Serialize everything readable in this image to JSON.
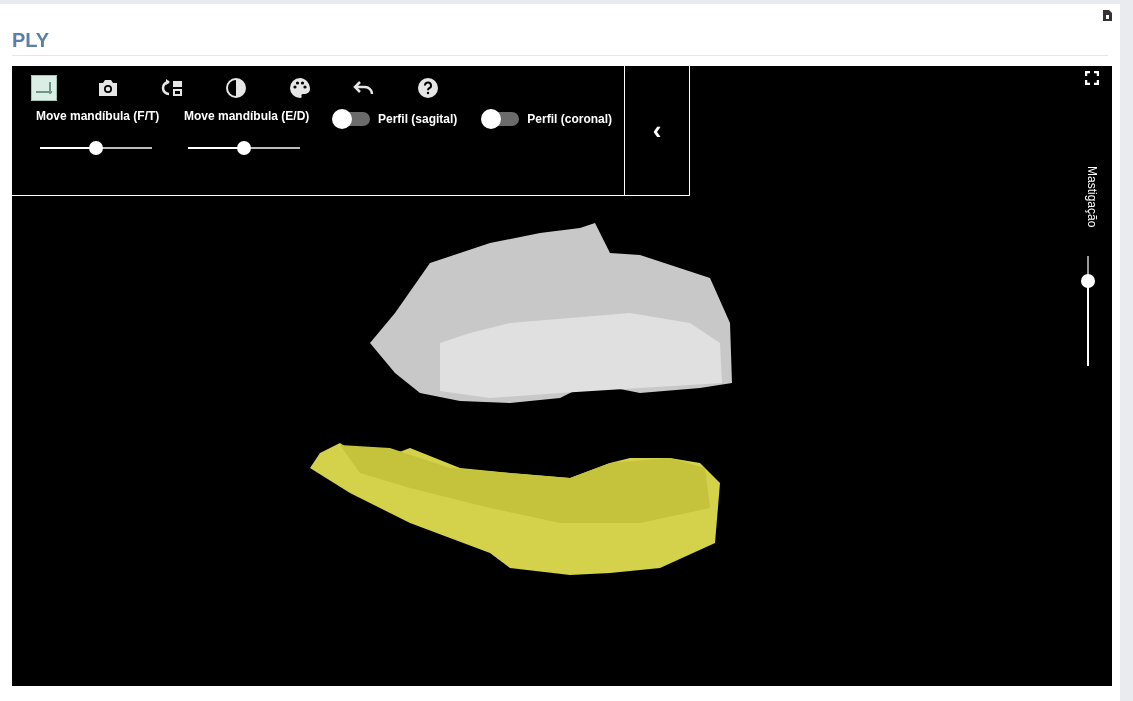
{
  "title": "PLY",
  "toolbar": {
    "tools": [
      {
        "kind": "axes",
        "selected": true
      },
      {
        "kind": "camera",
        "selected": false
      },
      {
        "kind": "swap",
        "selected": false
      },
      {
        "kind": "contrast",
        "selected": false
      },
      {
        "kind": "palette",
        "selected": false
      },
      {
        "kind": "undo",
        "selected": false
      },
      {
        "kind": "help",
        "selected": false
      }
    ],
    "sliders": [
      {
        "label": "Move mandíbula (F/T)",
        "level": 0.5
      },
      {
        "label": "Move mandíbula (E/D)",
        "level": 0.5
      }
    ],
    "toggles": [
      {
        "label": "Perfil (sagital)",
        "on": false
      },
      {
        "label": "Perfil (coronal)",
        "on": false
      }
    ],
    "collapse": "‹"
  },
  "side_slider": {
    "label": "Mastigação",
    "level": 0.77
  }
}
